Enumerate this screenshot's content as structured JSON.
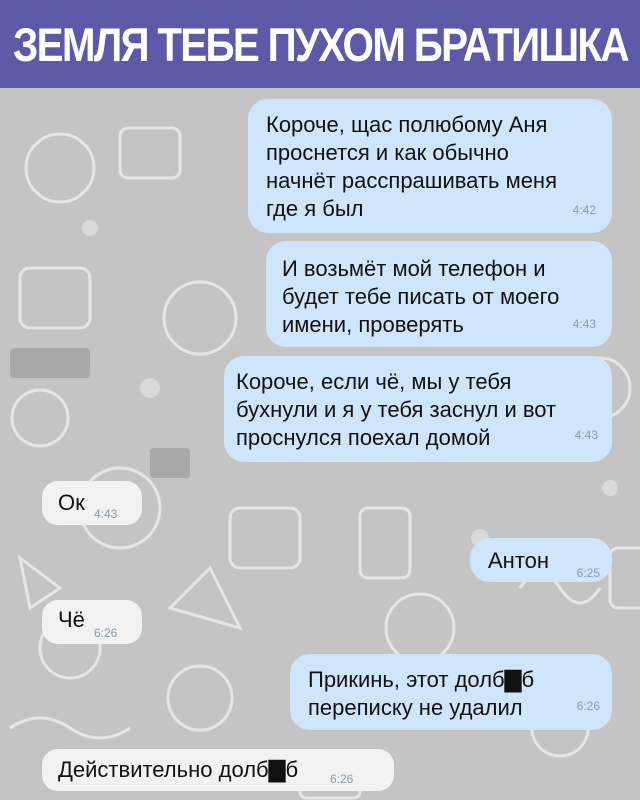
{
  "header": {
    "title": "ЗЕМЛЯ ТЕБЕ ПУХОМ БРАТИШКА"
  },
  "colors": {
    "header_bg": "#5c5aa6",
    "outgoing_bubble": "#cfe5fc",
    "incoming_bubble": "#f2f2f2",
    "timestamp": "#8a9aa6"
  },
  "messages": [
    {
      "direction": "outgoing",
      "text": "Короче, щас полюбому Аня\nпроснется и как обычно\nначнёт расспрашивать меня\nгде я был",
      "time": "4:42"
    },
    {
      "direction": "outgoing",
      "text": "И возьмёт мой телефон и\nбудет тебе писать от моего\nимени, проверять",
      "time": "4:43"
    },
    {
      "direction": "outgoing",
      "text": "Короче, если чё, мы у тебя\nбухнули и я у тебя заснул и вот\nпроснулся поехал домой",
      "time": "4:43"
    },
    {
      "direction": "incoming",
      "text": "Ок",
      "time": "4:43"
    },
    {
      "direction": "outgoing",
      "text": "Антон",
      "time": "6:25"
    },
    {
      "direction": "incoming",
      "text": "Чё",
      "time": "6:26"
    },
    {
      "direction": "outgoing",
      "text": "Прикинь, этот долб▇б\nпереписку не удалил",
      "time": "6:26"
    },
    {
      "direction": "incoming",
      "text": "Действительно долб▇б",
      "time": "6:26"
    }
  ]
}
